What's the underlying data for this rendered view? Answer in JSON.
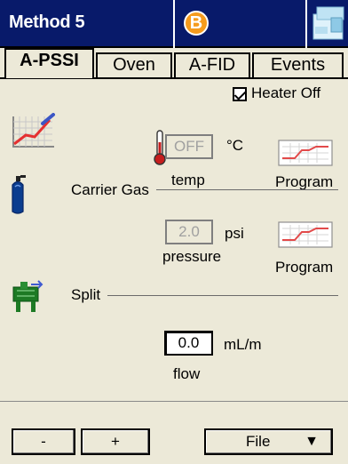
{
  "titlebar": {
    "title": "Method 5",
    "badge": "B",
    "icon": "instrument-icon"
  },
  "tabs": [
    {
      "label": "A-PSSI",
      "active": true
    },
    {
      "label": "Oven",
      "active": false
    },
    {
      "label": "A-FID",
      "active": false
    },
    {
      "label": "Events",
      "active": false
    }
  ],
  "heater": {
    "checkbox_checked": true,
    "label": "Heater Off"
  },
  "temperature": {
    "value": "OFF",
    "unit": "°C",
    "caption": "temp",
    "program_label": "Program"
  },
  "carrier_gas": {
    "section_label": "Carrier Gas",
    "value": "2.0",
    "unit": "psi",
    "caption": "pressure",
    "program_label": "Program"
  },
  "split": {
    "section_label": "Split",
    "value": "0.0",
    "unit": "mL/m",
    "caption": "flow"
  },
  "bottom_bar": {
    "minus_label": "-",
    "plus_label": "+",
    "file_label": "File",
    "file_arrow": "▼"
  },
  "icons": {
    "graph": "program-graph-icon",
    "thermometer": "thermometer-icon",
    "gas_cylinder": "gas-cylinder-icon",
    "split_valve": "split-valve-icon",
    "program": "program-icon"
  },
  "colors": {
    "title_bar": "#081a6a",
    "badge": "#f59b1d",
    "background": "#ece9d8"
  }
}
